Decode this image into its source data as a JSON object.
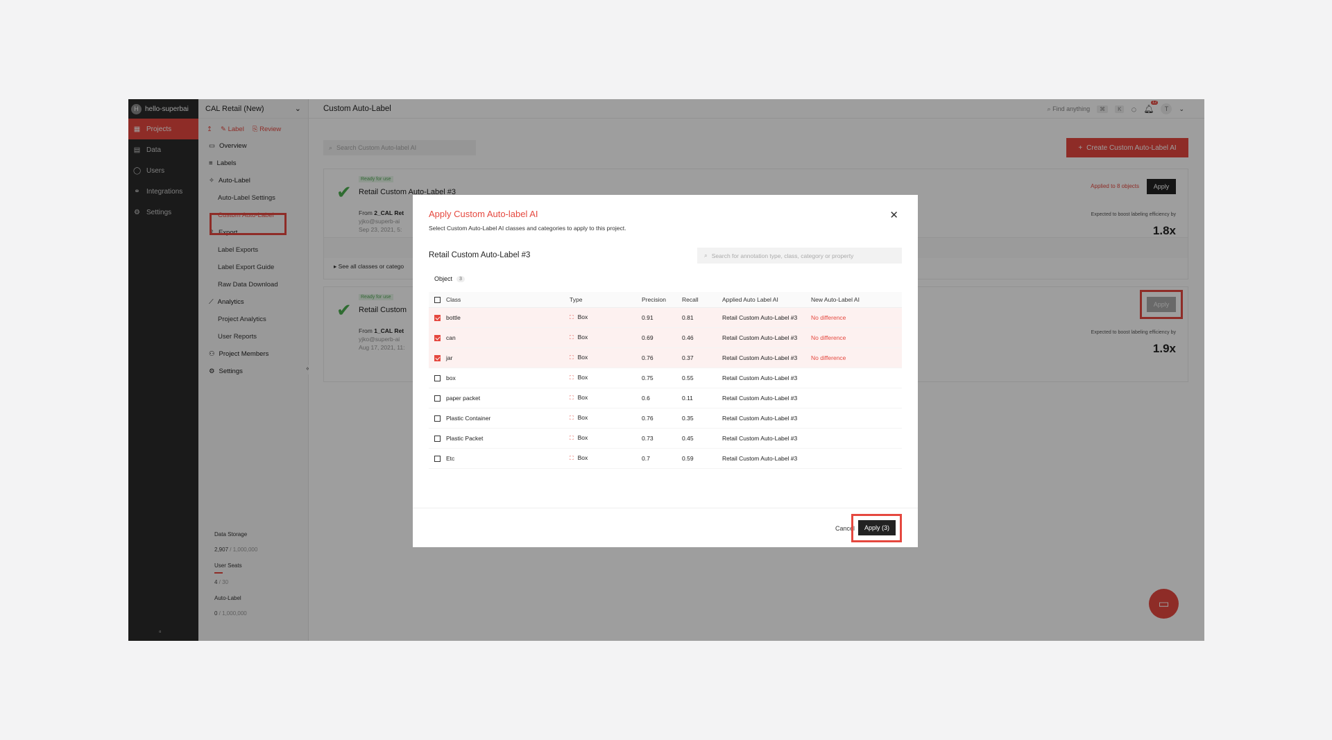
{
  "org": {
    "initial": "H",
    "name": "hello-superbai"
  },
  "rail": [
    {
      "icon": "▦",
      "label": "Projects"
    },
    {
      "icon": "▤",
      "label": "Data"
    },
    {
      "icon": "◯",
      "label": "Users"
    },
    {
      "icon": "⚭",
      "label": "Integrations"
    },
    {
      "icon": "⚙",
      "label": "Settings"
    }
  ],
  "rail_bottom_icon": "▫",
  "project": {
    "name": "CAL Retail (New)",
    "upload_icon": "↥",
    "label_action": "Label",
    "review_action": "Review",
    "nav": [
      {
        "label": "Overview",
        "icon": "▭"
      },
      {
        "label": "Labels",
        "icon": "≡"
      },
      {
        "label": "Auto-Label",
        "icon": "✧"
      },
      {
        "label": "Auto-Label Settings"
      },
      {
        "label": "Custom Auto-Label"
      },
      {
        "label": "Export",
        "icon": "⇪"
      },
      {
        "label": "Label Exports"
      },
      {
        "label": "Label Export Guide"
      },
      {
        "label": "Raw Data Download"
      },
      {
        "label": "Analytics",
        "icon": "⟋"
      },
      {
        "label": "Project Analytics"
      },
      {
        "label": "User Reports"
      },
      {
        "label": "Project Members",
        "icon": "⚇"
      },
      {
        "label": "Settings",
        "icon": "⚙"
      }
    ],
    "collapse": "«",
    "usage": {
      "storage_label": "Data Storage",
      "storage_used": "2,907",
      "storage_total": " / 1,000,000",
      "seats_label": "User Seats",
      "seats_used": "4",
      "seats_total": " / 30",
      "autolabel_label": "Auto-Label",
      "autolabel_used": "0",
      "autolabel_total": " / 1,000,000"
    }
  },
  "topbar": {
    "title": "Custom Auto-Label",
    "find_placeholder": "Find anything",
    "kbd1": "⌘",
    "kbd2": "K",
    "notif_count": "12",
    "avatar": "T"
  },
  "main": {
    "search_placeholder": "Search Custom Auto-label AI",
    "create_button": "Create Custom Auto-Label AI",
    "cards": [
      {
        "status": "Ready for use",
        "title": "Retail Custom Auto-Label #3",
        "from_prefix": "From ",
        "from_project": "2_CAL Ret",
        "author": "yjko@superb-ai",
        "date": "Sep 23, 2021, 5:",
        "applied": "Applied to 8 objects",
        "apply": "Apply",
        "boost_text": "Expected to boost labeling efficiency by",
        "boost_value": "1.8x",
        "see_all": "See all classes or catego"
      },
      {
        "status": "Ready for use",
        "title": "Retail Custom",
        "from_prefix": "From ",
        "from_project": "1_CAL Ret",
        "author": "yjko@superb-ai",
        "date": "Aug 17, 2021, 11:",
        "apply": "Apply",
        "boost_text": "Expected to boost labeling efficiency by",
        "boost_value": "1.9x"
      }
    ]
  },
  "modal": {
    "title": "Apply Custom Auto-label AI",
    "subtitle": "Select Custom Auto-Label AI classes and categories to apply to this project.",
    "ai_name": "Retail Custom Auto-Label #3",
    "search_placeholder": "Search for annotation type, class, category or property",
    "tab_label": "Object",
    "tab_count": "3",
    "columns": [
      "Class",
      "Type",
      "Precision",
      "Recall",
      "Applied Auto Label AI",
      "New Auto-Label AI"
    ],
    "rows": [
      {
        "checked": true,
        "class": "bottle",
        "type": "Box",
        "precision": "0.91",
        "recall": "0.81",
        "applied": "Retail Custom Auto-Label #3",
        "new": "No difference"
      },
      {
        "checked": true,
        "class": "can",
        "type": "Box",
        "precision": "0.69",
        "recall": "0.46",
        "applied": "Retail Custom Auto-Label #3",
        "new": "No difference"
      },
      {
        "checked": true,
        "class": "jar",
        "type": "Box",
        "precision": "0.76",
        "recall": "0.37",
        "applied": "Retail Custom Auto-Label #3",
        "new": "No difference"
      },
      {
        "checked": false,
        "class": "box",
        "type": "Box",
        "precision": "0.75",
        "recall": "0.55",
        "applied": "Retail Custom Auto-Label #3",
        "new": ""
      },
      {
        "checked": false,
        "class": "paper packet",
        "type": "Box",
        "precision": "0.6",
        "recall": "0.11",
        "applied": "Retail Custom Auto-Label #3",
        "new": ""
      },
      {
        "checked": false,
        "class": "Plastic Container",
        "type": "Box",
        "precision": "0.76",
        "recall": "0.35",
        "applied": "Retail Custom Auto-Label #3",
        "new": ""
      },
      {
        "checked": false,
        "class": "Plastic Packet",
        "type": "Box",
        "precision": "0.73",
        "recall": "0.45",
        "applied": "Retail Custom Auto-Label #3",
        "new": ""
      },
      {
        "checked": false,
        "class": "Etc",
        "type": "Box",
        "precision": "0.7",
        "recall": "0.59",
        "applied": "Retail Custom Auto-Label #3",
        "new": ""
      }
    ],
    "cancel": "Cancel",
    "apply": "Apply (3)"
  },
  "colors": {
    "accent": "#e5483f",
    "rail": "#2a2a2a",
    "ready": "#4caf50"
  }
}
